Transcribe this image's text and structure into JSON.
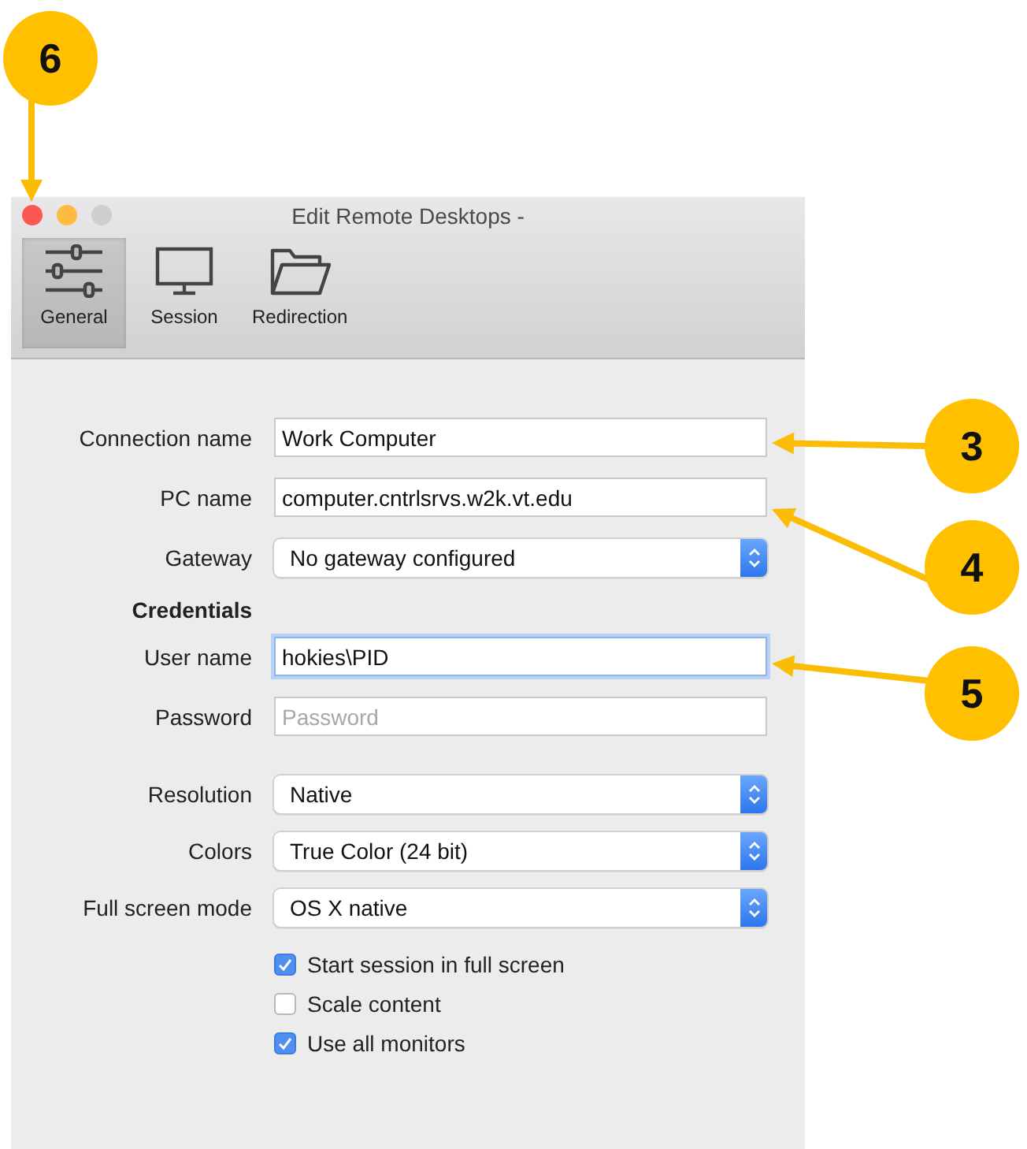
{
  "window": {
    "title": "Edit Remote Desktops -"
  },
  "toolbar": [
    {
      "label": "General",
      "selected": true
    },
    {
      "label": "Session",
      "selected": false
    },
    {
      "label": "Redirection",
      "selected": false
    }
  ],
  "sections": [
    {
      "rows": [
        {
          "kind": "text",
          "label": "Connection name",
          "value": "Work Computer",
          "focused": false
        },
        {
          "kind": "text",
          "label": "PC name",
          "value": "computer.cntrlsrvs.w2k.vt.edu",
          "focused": false
        },
        {
          "kind": "select",
          "label": "Gateway",
          "value": "No gateway configured"
        },
        {
          "kind": "heading",
          "label": "Credentials"
        },
        {
          "kind": "text",
          "label": "User name",
          "value": "hokies\\PID",
          "focused": true
        },
        {
          "kind": "text",
          "label": "Password",
          "placeholder": "Password",
          "focused": false
        }
      ]
    },
    {
      "rows": [
        {
          "kind": "select",
          "label": "Resolution",
          "value": "Native"
        },
        {
          "kind": "select",
          "label": "Colors",
          "value": "True Color (24 bit)"
        },
        {
          "kind": "select",
          "label": "Full screen mode",
          "value": "OS X native"
        },
        {
          "kind": "checkbox",
          "label": "Start session in full screen",
          "checked": true
        },
        {
          "kind": "checkbox",
          "label": "Scale content",
          "checked": false
        },
        {
          "kind": "checkbox",
          "label": "Use all monitors",
          "checked": true
        }
      ]
    }
  ],
  "callouts": [
    {
      "number": "6"
    },
    {
      "number": "3"
    },
    {
      "number": "4"
    },
    {
      "number": "5"
    }
  ]
}
